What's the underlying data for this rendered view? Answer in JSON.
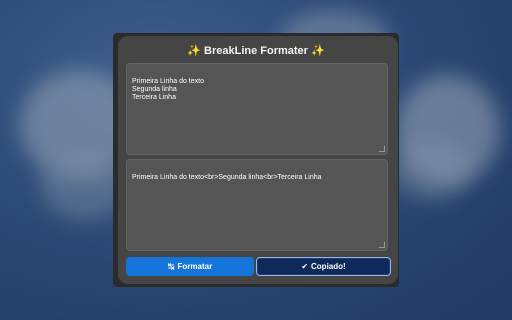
{
  "app": {
    "title": "✨ BreakLine Formater ✨"
  },
  "input": {
    "value": "Primeira Linha do texto\nSegunda linha\nTerceira Linha"
  },
  "output": {
    "value": "Primeira Linha do texto<br>Segunda linha<br>Terceira Linha"
  },
  "buttons": {
    "format_icon": "↹",
    "format_label": "Formatar",
    "copy_icon": "✔",
    "copy_label": "Copiado!"
  },
  "colors": {
    "format_button": "#1474d9",
    "copy_button": "#0d2a5b"
  }
}
